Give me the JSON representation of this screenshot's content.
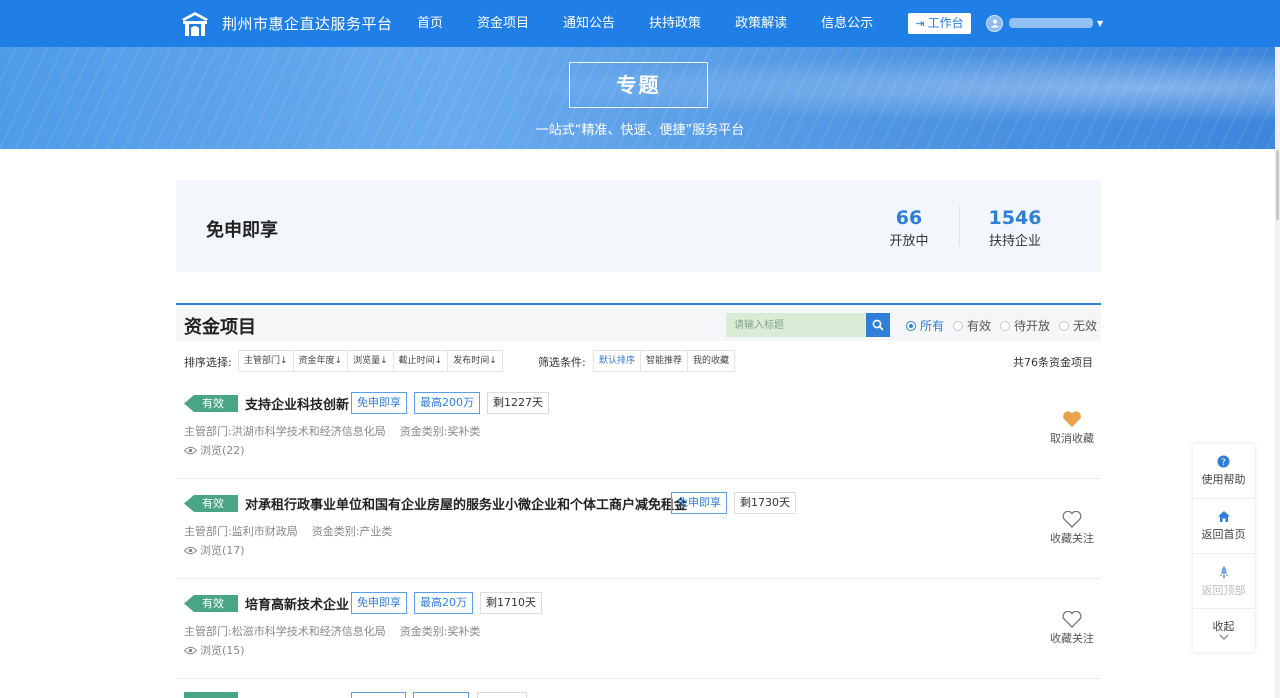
{
  "header": {
    "site_title": "荆州市惠企直达服务平台",
    "nav": [
      "首页",
      "资金项目",
      "通知公告",
      "扶持政策",
      "政策解读",
      "信息公示"
    ],
    "workbench_label": "工作台",
    "brand_color": "#1f7fe6"
  },
  "banner": {
    "title": "专题",
    "subtitle": "一站式“精准、快速、便捷”服务平台"
  },
  "summary": {
    "title": "免申即享",
    "stats": [
      {
        "value": "66",
        "label": "开放中"
      },
      {
        "value": "1546",
        "label": "扶持企业"
      }
    ]
  },
  "fund_section": {
    "title": "资金项目",
    "search_placeholder": "请输入标题",
    "status_filters": [
      "所有",
      "有效",
      "待开放",
      "无效"
    ],
    "active_status": "所有",
    "sort_label": "排序选择:",
    "sort_options": [
      "主管部门↓",
      "资金年度↓",
      "浏览量↓",
      "截止时间↓",
      "发布时间↓"
    ],
    "filter_label": "筛选条件:",
    "filter_options": [
      "默认排序",
      "智能推荐",
      "我的收藏"
    ],
    "active_filter": "默认排序",
    "total_text": "共76条资金项目"
  },
  "items": [
    {
      "badge": "有效",
      "title": "支持企业科技创新",
      "tags": [
        "免申即享",
        "最高200万",
        "剩1227天"
      ],
      "department": "主管部门:洪湖市科学技术和经济信息化局",
      "category": "资金类别:奖补类",
      "views": "浏览(22)",
      "fav_label": "取消收藏",
      "favorited": true
    },
    {
      "badge": "有效",
      "title": "对承租行政事业单位和国有企业房屋的服务业小微企业和个体工商户减免租金",
      "tags": [
        "免申即享",
        "剩1730天"
      ],
      "department": "主管部门:监利市财政局",
      "category": "资金类别:产业类",
      "views": "浏览(17)",
      "fav_label": "收藏关注",
      "favorited": false
    },
    {
      "badge": "有效",
      "title": "培育高新技术企业",
      "tags": [
        "免申即享",
        "最高20万",
        "剩1710天"
      ],
      "department": "主管部门:松滋市科学技术和经济信息化局",
      "category": "资金类别:奖补类",
      "views": "浏览(15)",
      "fav_label": "收藏关注",
      "favorited": false
    }
  ],
  "float_panel": [
    "使用帮助",
    "返回首页",
    "返回顶部",
    "收起"
  ],
  "colors": {
    "accent": "#2f7ed8",
    "valid_badge": "#4aa587",
    "favorite": "#e9a24a"
  }
}
